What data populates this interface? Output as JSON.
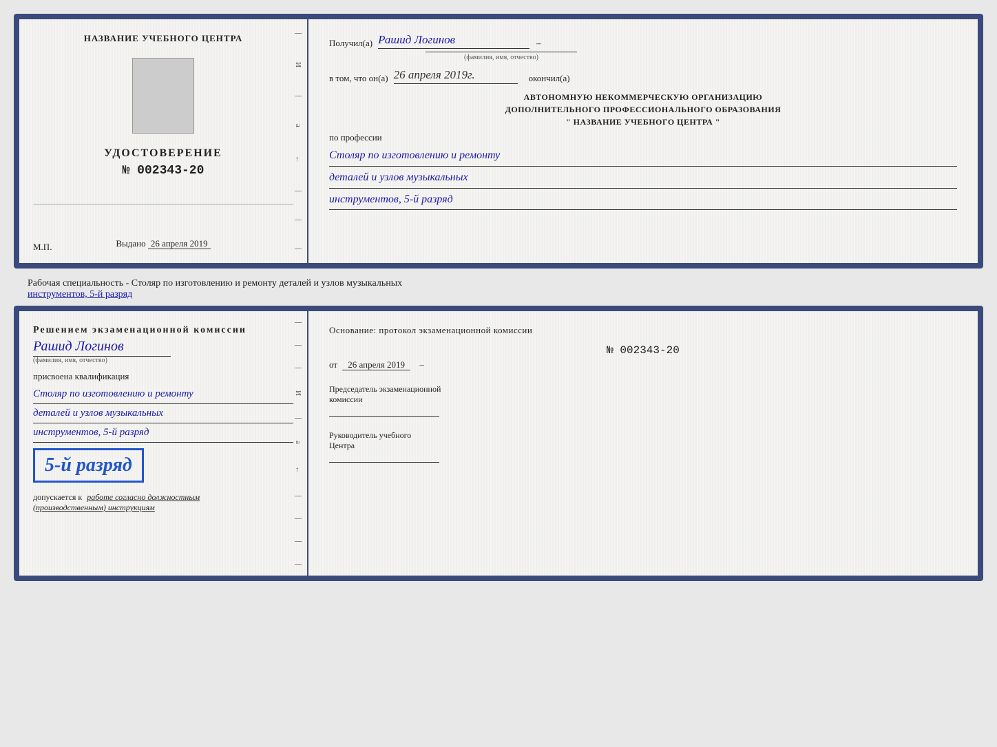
{
  "top_doc": {
    "left": {
      "center_title": "НАЗВАНИЕ УЧЕБНОГО ЦЕНТРА",
      "cert_title": "УДОСТОВЕРЕНИЕ",
      "cert_number": "№ 002343-20",
      "issued_label": "Выдано",
      "issued_date": "26 апреля 2019",
      "mp": "М.П."
    },
    "right": {
      "received_label": "Получил(а)",
      "received_name": "Рашид Логинов",
      "name_sublabel": "(фамилия, имя, отчество)",
      "in_that_label": "в том, что он(а)",
      "in_that_date": "26 апреля 2019г.",
      "finished_label": "окончил(а)",
      "org_title_line1": "АВТОНОМНУЮ НЕКОММЕРЧЕСКУЮ ОРГАНИЗАЦИЮ",
      "org_title_line2": "ДОПОЛНИТЕЛЬНОГО ПРОФЕССИОНАЛЬНОГО ОБРАЗОВАНИЯ",
      "org_title_line3": "\"  НАЗВАНИЕ УЧЕБНОГО ЦЕНТРА  \"",
      "profession_label": "по профессии",
      "profession_line1": "Столяр по изготовлению и ремонту",
      "profession_line2": "деталей и узлов музыкальных",
      "profession_line3": "инструментов, 5-й разряд"
    }
  },
  "middle_text": {
    "main": "Рабочая специальность - Столяр по изготовлению и ремонту деталей и узлов музыкальных",
    "underlined": "инструментов, 5-й разряд"
  },
  "bottom_doc": {
    "left": {
      "commission_title": "Решением  экзаменационной  комиссии",
      "name": "Рашид Логинов",
      "name_sublabel": "(фамилия, имя, отчество)",
      "qualification_label": "присвоена квалификация",
      "qual_line1": "Столяр по изготовлению и ремонту",
      "qual_line2": "деталей и узлов музыкальных",
      "qual_line3": "инструментов, 5-й разряд",
      "rank_text": "5-й разряд",
      "допускается": "допускается к",
      "work_label": "работе согласно должностным",
      "instructions": "(производственным) инструкциям"
    },
    "right": {
      "basis_label": "Основание: протокол экзаменационной  комиссии",
      "protocol_number": "№  002343-20",
      "from_label": "от",
      "from_date": "26 апреля 2019",
      "chairman_label": "Председатель экзаменационной",
      "chairman_label2": "комиссии",
      "director_label": "Руководитель учебного",
      "director_label2": "Центра"
    }
  }
}
